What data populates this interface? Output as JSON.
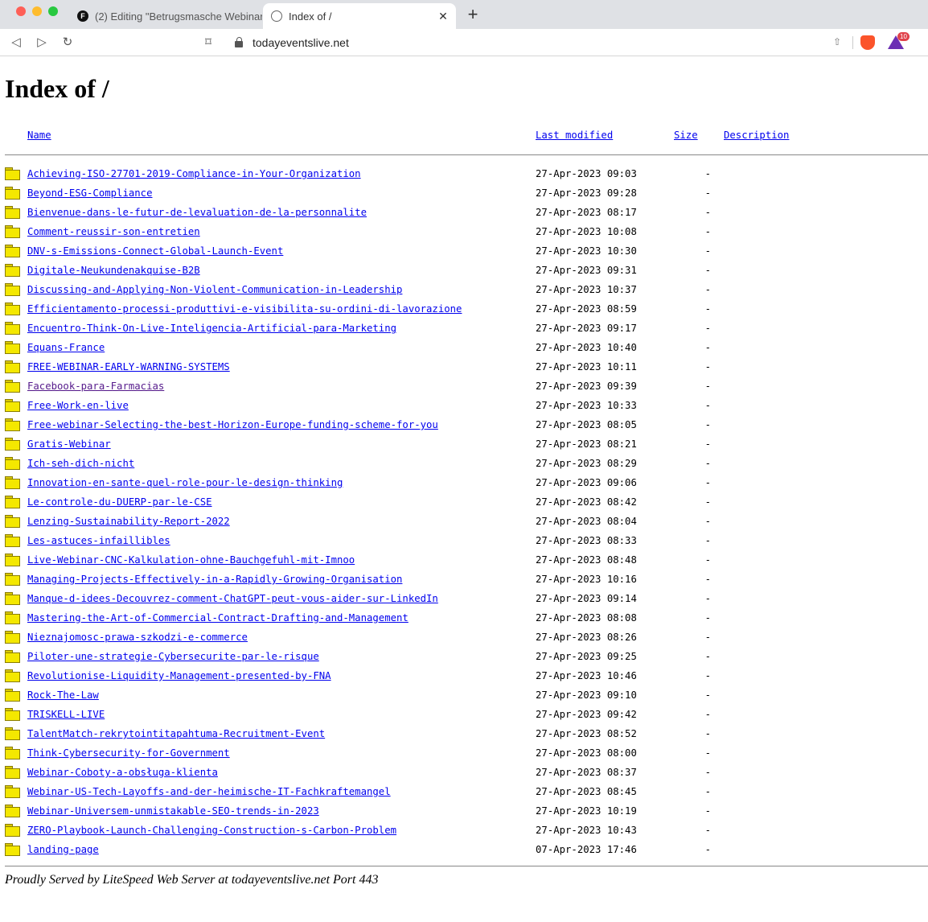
{
  "browser": {
    "tabs": [
      {
        "title": "(2) Editing \"Betrugsmasche Webinar",
        "active": false
      },
      {
        "title": "Index of /",
        "active": true
      }
    ],
    "url": "todayeventslive.net",
    "rewards_count": "10"
  },
  "page": {
    "heading": "Index of /",
    "columns": {
      "name": "Name",
      "last_modified": "Last modified",
      "size": "Size",
      "description": "Description"
    },
    "entries": [
      {
        "name": "Achieving-ISO-27701-2019-Compliance-in-Your-Organization",
        "date": "27-Apr-2023 09:03",
        "size": "-"
      },
      {
        "name": "Beyond-ESG-Compliance",
        "date": "27-Apr-2023 09:28",
        "size": "-"
      },
      {
        "name": "Bienvenue-dans-le-futur-de-levaluation-de-la-personnalite",
        "date": "27-Apr-2023 08:17",
        "size": "-"
      },
      {
        "name": "Comment-reussir-son-entretien",
        "date": "27-Apr-2023 10:08",
        "size": "-"
      },
      {
        "name": "DNV-s-Emissions-Connect-Global-Launch-Event",
        "date": "27-Apr-2023 10:30",
        "size": "-"
      },
      {
        "name": "Digitale-Neukundenakquise-B2B",
        "date": "27-Apr-2023 09:31",
        "size": "-"
      },
      {
        "name": "Discussing-and-Applying-Non-Violent-Communication-in-Leadership",
        "date": "27-Apr-2023 10:37",
        "size": "-"
      },
      {
        "name": "Efficientamento-processi-produttivi-e-visibilita-su-ordini-di-lavorazione",
        "date": "27-Apr-2023 08:59",
        "size": "-"
      },
      {
        "name": "Encuentro-Think-On-Live-Inteligencia-Artificial-para-Marketing",
        "date": "27-Apr-2023 09:17",
        "size": "-"
      },
      {
        "name": "Equans-France",
        "date": "27-Apr-2023 10:40",
        "size": "-"
      },
      {
        "name": "FREE-WEBINAR-EARLY-WARNING-SYSTEMS",
        "date": "27-Apr-2023 10:11",
        "size": "-"
      },
      {
        "name": "Facebook-para-Farmacias",
        "date": "27-Apr-2023 09:39",
        "size": "-",
        "visited": true
      },
      {
        "name": "Free-Work-en-live",
        "date": "27-Apr-2023 10:33",
        "size": "-"
      },
      {
        "name": "Free-webinar-Selecting-the-best-Horizon-Europe-funding-scheme-for-you",
        "date": "27-Apr-2023 08:05",
        "size": "-"
      },
      {
        "name": "Gratis-Webinar",
        "date": "27-Apr-2023 08:21",
        "size": "-"
      },
      {
        "name": "Ich-seh-dich-nicht",
        "date": "27-Apr-2023 08:29",
        "size": "-"
      },
      {
        "name": "Innovation-en-sante-quel-role-pour-le-design-thinking",
        "date": "27-Apr-2023 09:06",
        "size": "-"
      },
      {
        "name": "Le-controle-du-DUERP-par-le-CSE",
        "date": "27-Apr-2023 08:42",
        "size": "-"
      },
      {
        "name": "Lenzing-Sustainability-Report-2022",
        "date": "27-Apr-2023 08:04",
        "size": "-"
      },
      {
        "name": "Les-astuces-infaillibles",
        "date": "27-Apr-2023 08:33",
        "size": "-"
      },
      {
        "name": "Live-Webinar-CNC-Kalkulation-ohne-Bauchgefuhl-mit-Imnoo",
        "date": "27-Apr-2023 08:48",
        "size": "-"
      },
      {
        "name": "Managing-Projects-Effectively-in-a-Rapidly-Growing-Organisation",
        "date": "27-Apr-2023 10:16",
        "size": "-"
      },
      {
        "name": "Manque-d-idees-Decouvrez-comment-ChatGPT-peut-vous-aider-sur-LinkedIn",
        "date": "27-Apr-2023 09:14",
        "size": "-"
      },
      {
        "name": "Mastering-the-Art-of-Commercial-Contract-Drafting-and-Management",
        "date": "27-Apr-2023 08:08",
        "size": "-"
      },
      {
        "name": "Nieznajomosc-prawa-szkodzi-e-commerce",
        "date": "27-Apr-2023 08:26",
        "size": "-"
      },
      {
        "name": "Piloter-une-strategie-Cybersecurite-par-le-risque",
        "date": "27-Apr-2023 09:25",
        "size": "-"
      },
      {
        "name": "Revolutionise-Liquidity-Management-presented-by-FNA",
        "date": "27-Apr-2023 10:46",
        "size": "-"
      },
      {
        "name": "Rock-The-Law",
        "date": "27-Apr-2023 09:10",
        "size": "-"
      },
      {
        "name": "TRISKELL-LIVE",
        "date": "27-Apr-2023 09:42",
        "size": "-"
      },
      {
        "name": "TalentMatch-rekrytointitapahtuma-Recruitment-Event",
        "date": "27-Apr-2023 08:52",
        "size": "-"
      },
      {
        "name": "Think-Cybersecurity-for-Government",
        "date": "27-Apr-2023 08:00",
        "size": "-"
      },
      {
        "name": "Webinar-Coboty-a-obsługa-klienta",
        "date": "27-Apr-2023 08:37",
        "size": "-"
      },
      {
        "name": "Webinar-US-Tech-Layoffs-and-der-heimische-IT-Fachkraftemangel",
        "date": "27-Apr-2023 08:45",
        "size": "-"
      },
      {
        "name": "Webinar-Universem-unmistakable-SEO-trends-in-2023",
        "date": "27-Apr-2023 10:19",
        "size": "-"
      },
      {
        "name": "ZERO-Playbook-Launch-Challenging-Construction-s-Carbon-Problem",
        "date": "27-Apr-2023 10:43",
        "size": "-"
      },
      {
        "name": "landing-page",
        "date": "07-Apr-2023 17:46",
        "size": "-"
      }
    ],
    "footer": "Proudly Served by LiteSpeed Web Server at todayeventslive.net Port 443"
  }
}
